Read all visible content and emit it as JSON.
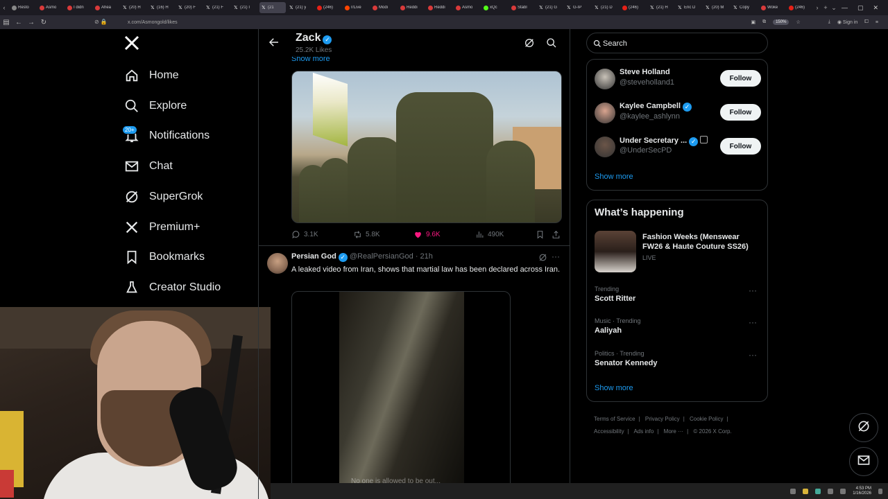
{
  "browser": {
    "tabs": [
      {
        "label": "Resto",
        "fav": "#888"
      },
      {
        "label": "Asmo",
        "fav": "#d93a3a"
      },
      {
        "label": "I didn",
        "fav": "#d93a3a"
      },
      {
        "label": "Ahea",
        "fav": "#d93a3a"
      },
      {
        "label": "(20) H",
        "fav": "x"
      },
      {
        "label": "(16) H",
        "fav": "x"
      },
      {
        "label": "(20) F",
        "fav": "x"
      },
      {
        "label": "(21) F",
        "fav": "x"
      },
      {
        "label": "(21) I",
        "fav": "x"
      },
      {
        "label": "(21",
        "fav": "x",
        "active": true
      },
      {
        "label": "(21) y",
        "fav": "x"
      },
      {
        "label": "(246)",
        "fav": "#e62117"
      },
      {
        "label": "r/Live",
        "fav": "#ff4500"
      },
      {
        "label": "Modi",
        "fav": "#d93a3a"
      },
      {
        "label": "Reddi",
        "fav": "#d93a3a"
      },
      {
        "label": "Reddi",
        "fav": "#d93a3a"
      },
      {
        "label": "Asmo",
        "fav": "#d93a3a"
      },
      {
        "label": "xQc",
        "fav": "#53fc18"
      },
      {
        "label": "Stabl",
        "fav": "#d93a3a"
      },
      {
        "label": "(21) G",
        "fav": "x"
      },
      {
        "label": "G-IP",
        "fav": "x"
      },
      {
        "label": "(21) D",
        "fav": "x"
      },
      {
        "label": "(246)",
        "fav": "#e62117"
      },
      {
        "label": "(21) H",
        "fav": "x"
      },
      {
        "label": "Eric D",
        "fav": "x"
      },
      {
        "label": "(20) M",
        "fav": "x"
      },
      {
        "label": "Copy",
        "fav": "x"
      },
      {
        "label": "Woke",
        "fav": "#d93a3a"
      },
      {
        "label": "(246)",
        "fav": "#e62117"
      }
    ],
    "url": "x.com/Asmongold/likes",
    "zoom": "150%",
    "sign_in": "Sign in"
  },
  "nav": {
    "logo": "X",
    "notification_badge": "20+",
    "items": [
      {
        "label": "Home",
        "icon": "home-icon"
      },
      {
        "label": "Explore",
        "icon": "search-icon"
      },
      {
        "label": "Notifications",
        "icon": "bell-icon"
      },
      {
        "label": "Chat",
        "icon": "mail-icon"
      },
      {
        "label": "SuperGrok",
        "icon": "grok-icon"
      },
      {
        "label": "Premium+",
        "icon": "x-logo-icon"
      },
      {
        "label": "Bookmarks",
        "icon": "bookmark-icon"
      },
      {
        "label": "Creator Studio",
        "icon": "flask-icon"
      }
    ]
  },
  "profile_header": {
    "name": "Zack",
    "likes": "25.2K Likes"
  },
  "feed": {
    "show_more": "Show more",
    "tweet1_actions": {
      "replies": "3.1K",
      "reposts": "5.8K",
      "likes": "9.6K",
      "views": "490K"
    },
    "tweet2": {
      "author_name": "Persian God",
      "author_handle": "@RealPersianGod",
      "time": "· 21h",
      "text": "A leaked video from Iran, shows that martial law has been declared across Iran.",
      "video_caption": "No one is allowed to be out..."
    }
  },
  "sidebar": {
    "search_placeholder": "Search",
    "who_to_follow": [
      {
        "name": "Steve Holland",
        "handle": "@steveholland1",
        "verified": false,
        "avatar_color": "#c8c2b8"
      },
      {
        "name": "Kaylee Campbell",
        "handle": "@kaylee_ashlynn",
        "verified": true,
        "avatar_color": "#d9a48f"
      },
      {
        "name": "Under Secretary ...",
        "handle": "@UnderSecPD",
        "verified": true,
        "avatar_color": "#6b5548"
      }
    ],
    "follow_label": "Follow",
    "show_more": "Show more",
    "whats_happening": {
      "title": "What’s happening",
      "event": {
        "title": "Fashion Weeks (Menswear FW26 & Haute Couture SS26)",
        "status": "LIVE"
      },
      "trends": [
        {
          "context": "Trending",
          "name": "Scott Ritter"
        },
        {
          "context": "Music · Trending",
          "name": "Aaliyah"
        },
        {
          "context": "Politics · Trending",
          "name": "Senator Kennedy"
        }
      ],
      "show_more": "Show more"
    },
    "footer": {
      "links": [
        "Terms of Service",
        "Privacy Policy",
        "Cookie Policy",
        "Accessibility",
        "Ads info",
        "More ···"
      ],
      "copyright": "© 2026 X Corp."
    }
  },
  "taskbar": {
    "time": "4:53 PM",
    "date": "1/16/2026"
  },
  "colors": {
    "accent": "#1d9bf0",
    "like": "#f91880",
    "text": "#e7e9ea",
    "muted": "#71767b",
    "border": "#2f3336"
  }
}
